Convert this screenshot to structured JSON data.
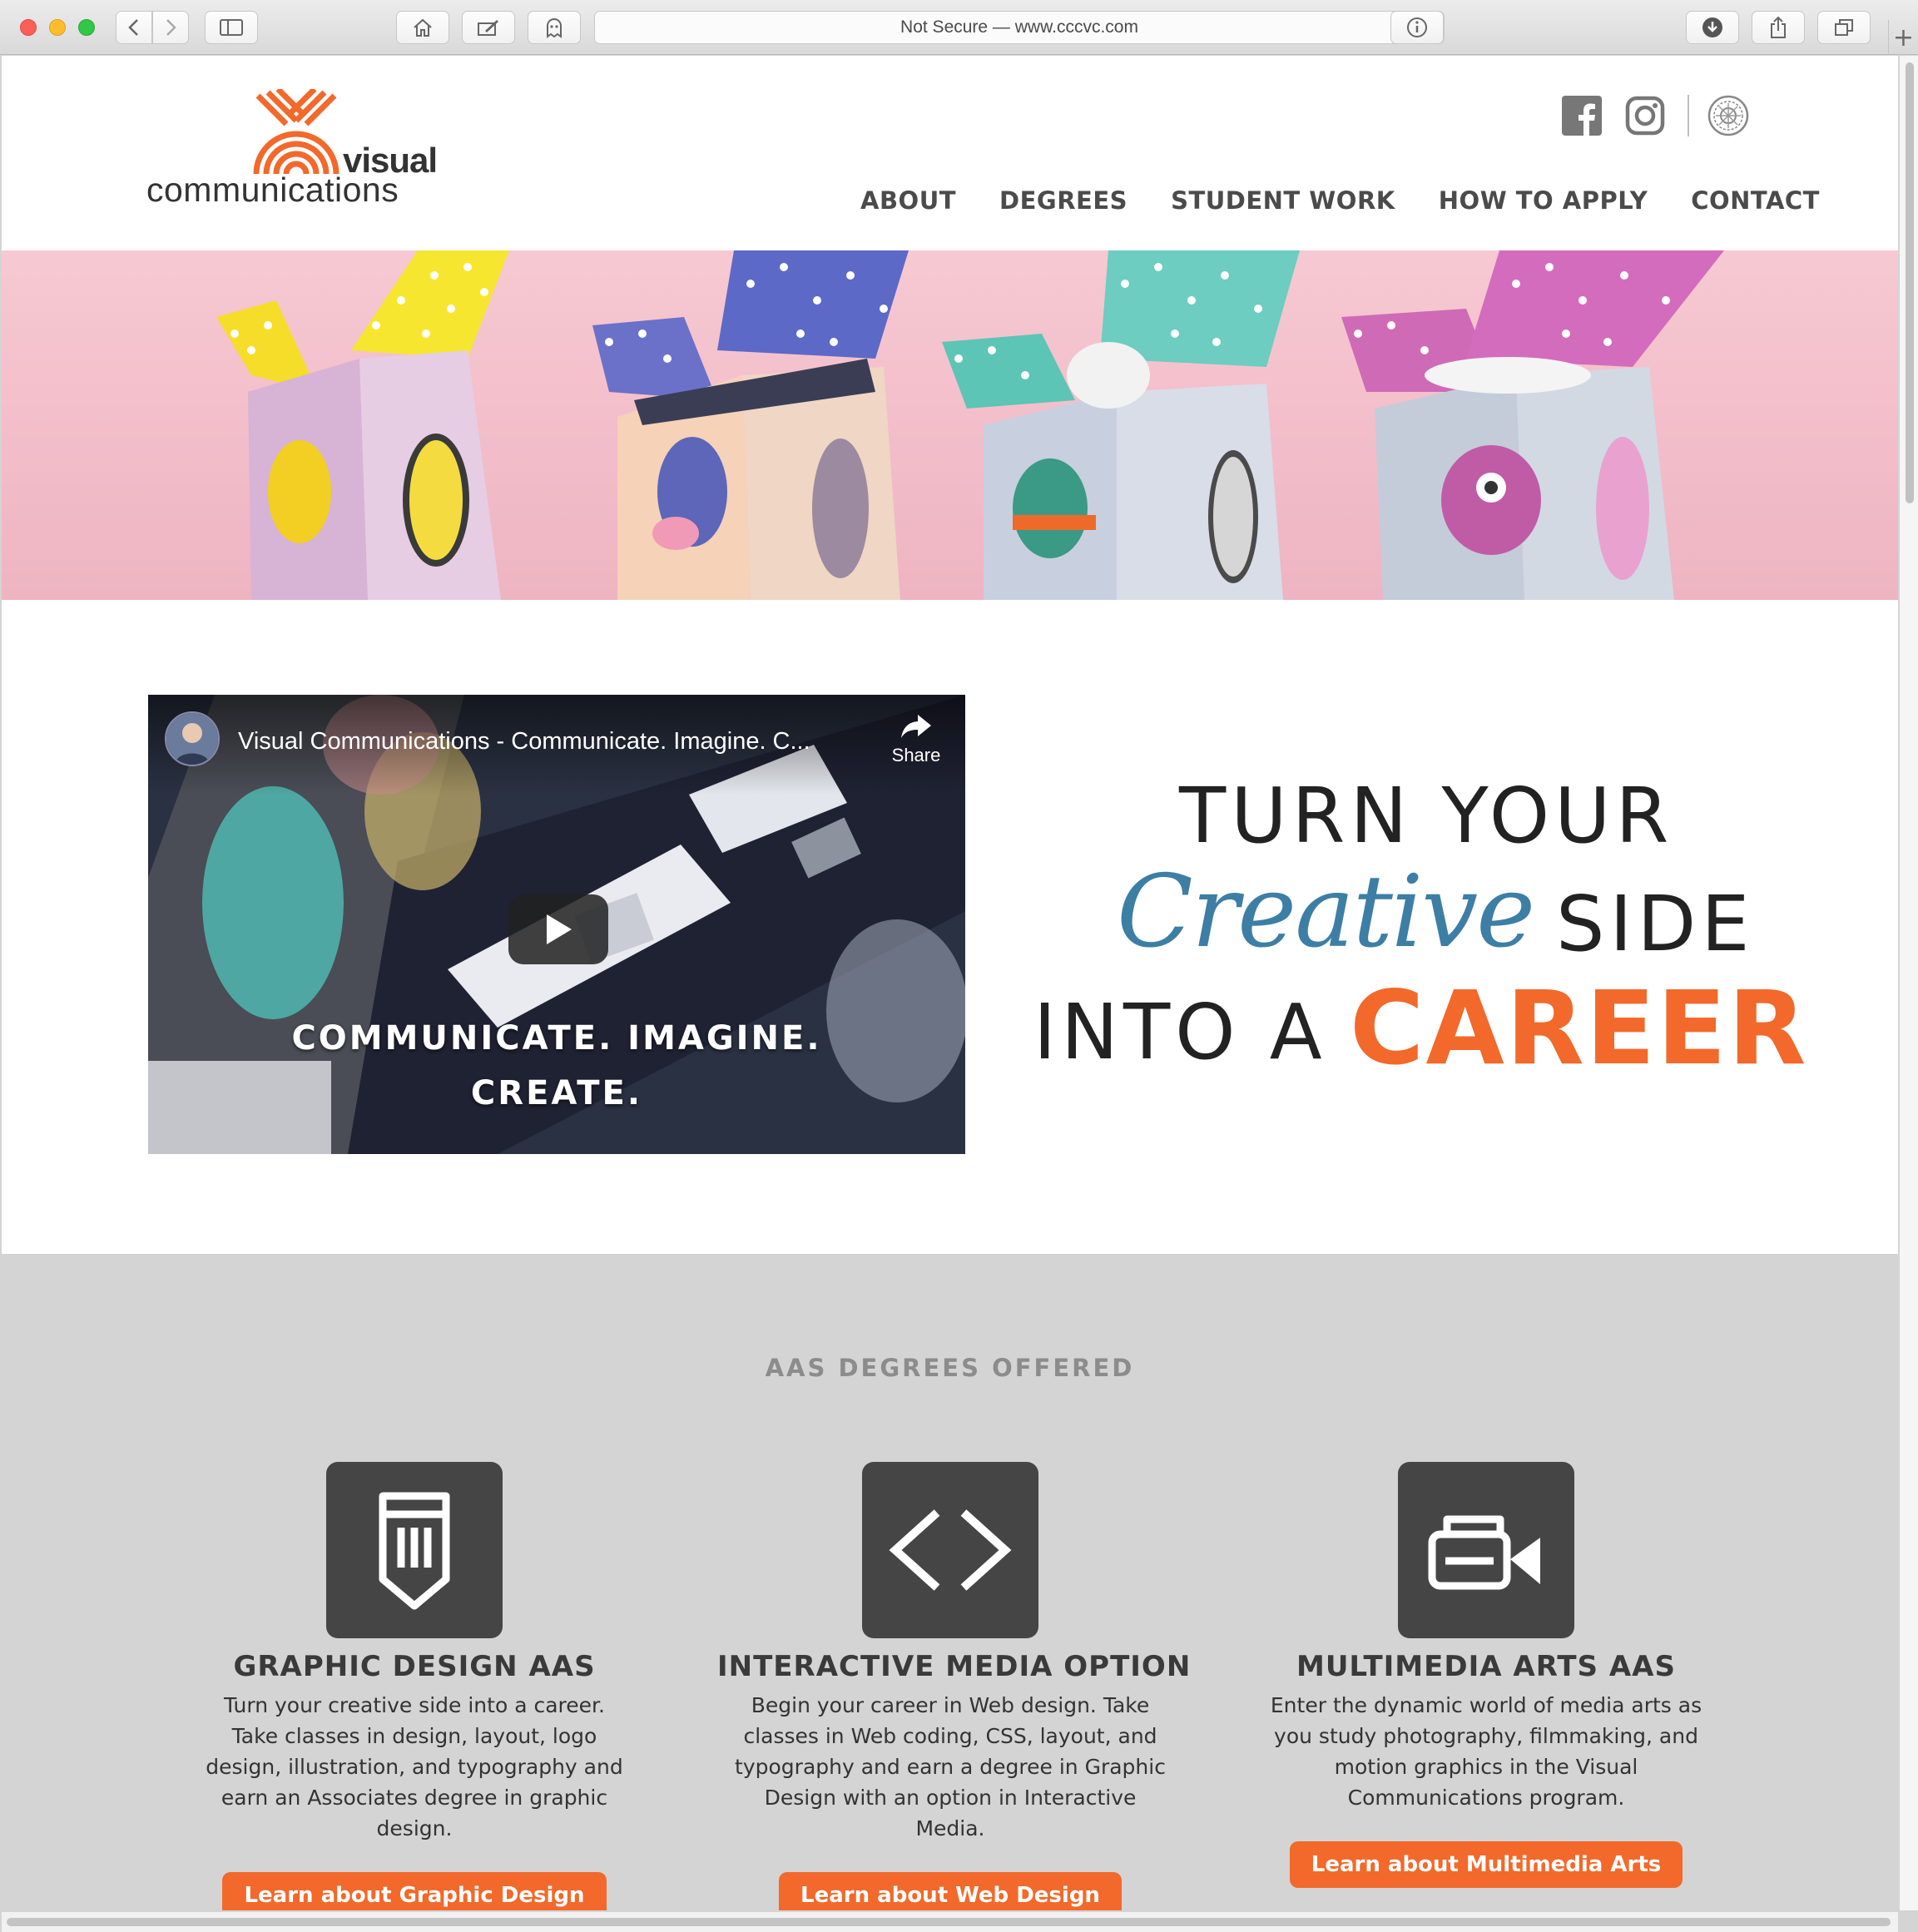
{
  "browser": {
    "url_text": "Not Secure — www.cccvc.com",
    "new_tab_label": "+"
  },
  "logo": {
    "word1": "visual",
    "word2": "communications",
    "accent_color": "#f2692b"
  },
  "social": {
    "icons": [
      "facebook-icon",
      "instagram-icon",
      "college-seal-icon"
    ]
  },
  "nav": {
    "items": [
      "ABOUT",
      "DEGREES",
      "STUDENT WORK",
      "HOW TO APPLY",
      "CONTACT"
    ]
  },
  "video": {
    "title": "Visual Communications - Communicate. Imagine. C...",
    "share_label": "Share",
    "caption_line1": "COMMUNICATE. IMAGINE.",
    "caption_line2": "CREATE."
  },
  "tagline": {
    "line1": "TURN YOUR",
    "creative": "Creative",
    "side": "SIDE",
    "into": "INTO A",
    "career": "CAREER",
    "career_color": "#f2692b",
    "creative_color": "#3d7ea5"
  },
  "degrees": {
    "heading": "AAS DEGREES OFFERED",
    "items": [
      {
        "title": "GRAPHIC DESIGN AAS",
        "description": "Turn your creative side into a career. Take classes in design, layout, logo design, illustration, and typography and earn an Associates degree in graphic design.",
        "button": "Learn about Graphic Design",
        "icon": "pencil-icon"
      },
      {
        "title": "INTERACTIVE MEDIA OPTION",
        "description": "Begin your career in Web design. Take classes in Web coding, CSS, layout, and typography and earn a degree in Graphic Design with an option in Interactive Media.",
        "button": "Learn about Web Design",
        "icon": "code-brackets-icon"
      },
      {
        "title": "MULTIMEDIA ARTS AAS",
        "description": "Enter the dynamic world of media arts as you study photography, filmmaking, and motion graphics in the Visual Communications program.",
        "button": "Learn about Multimedia Arts",
        "icon": "video-camera-icon"
      }
    ]
  }
}
